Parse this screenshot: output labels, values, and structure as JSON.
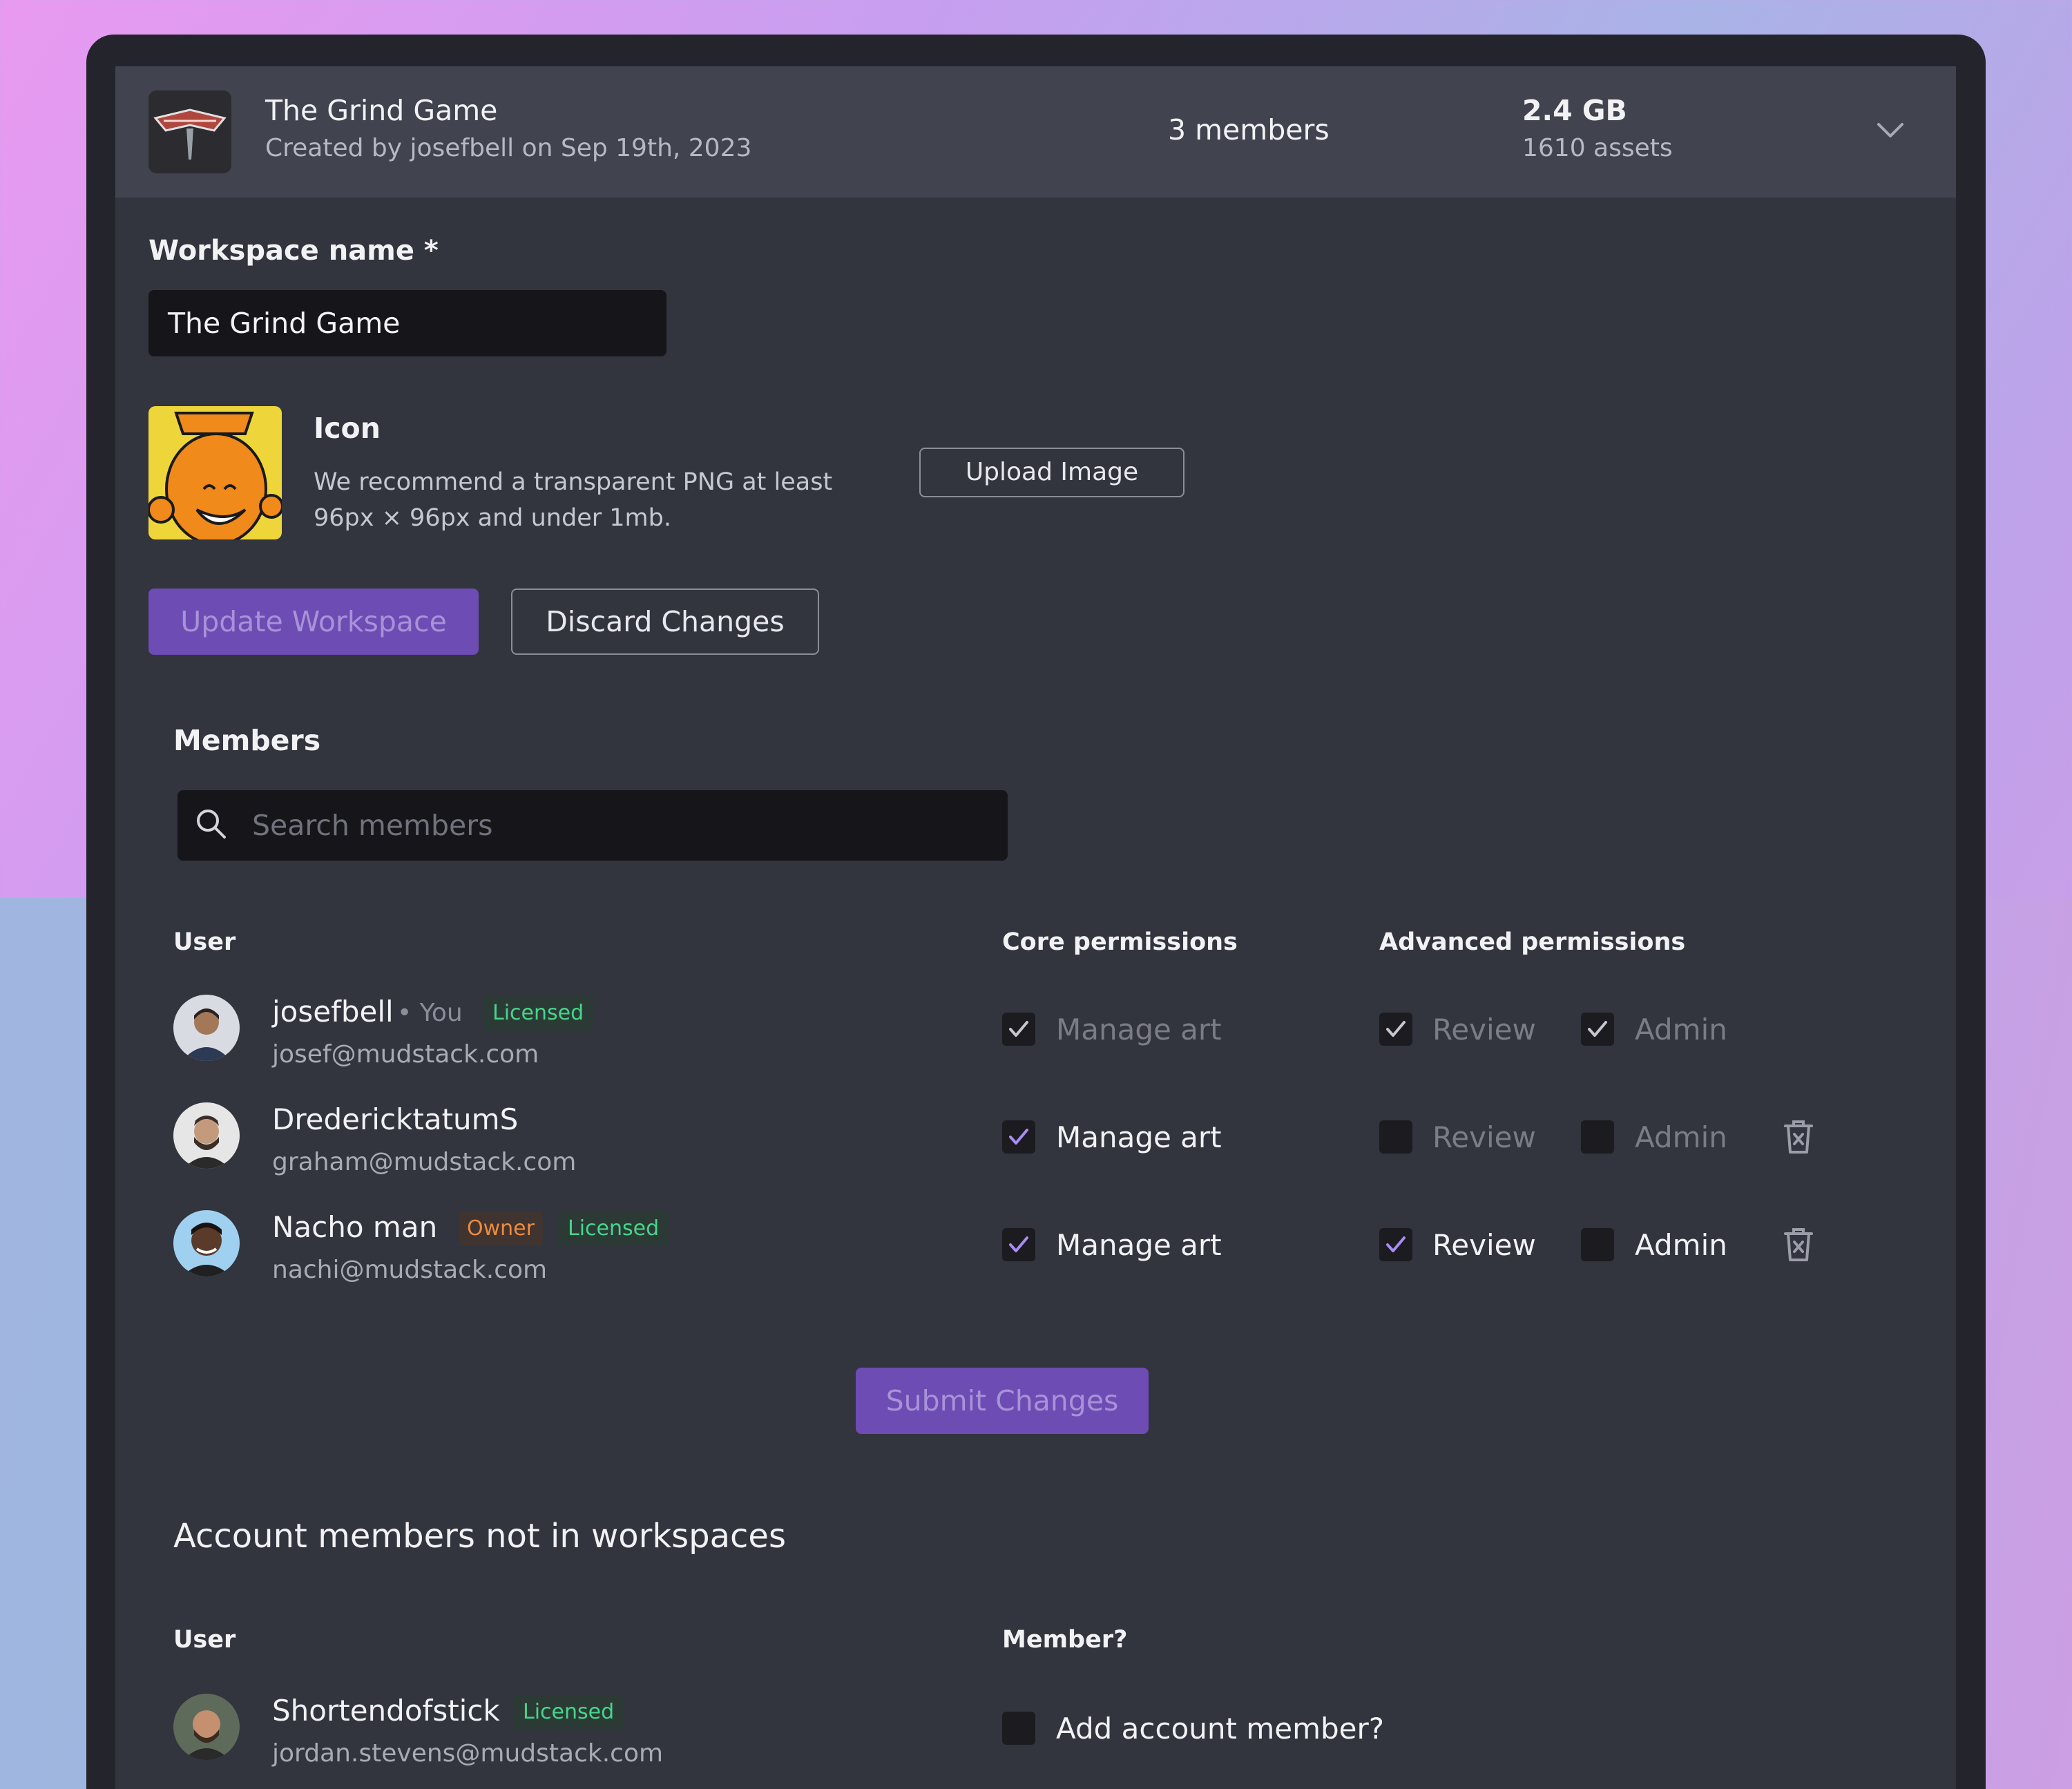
{
  "workspace": {
    "title": "The Grind Game",
    "subtitle": "Created by josefbell on Sep 19th, 2023",
    "members_count": "3 members",
    "size": "2.4 GB",
    "assets": "1610 assets"
  },
  "form": {
    "name_label": "Workspace name *",
    "name_value": "The Grind Game",
    "icon_label": "Icon",
    "icon_desc_1": "We recommend a transparent PNG at least",
    "icon_desc_2": "96px × 96px and under 1mb.",
    "upload_label": "Upload Image",
    "update_label": "Update Workspace",
    "discard_label": "Discard Changes"
  },
  "members": {
    "title": "Members",
    "search_placeholder": "Search members",
    "col_user": "User",
    "col_core": "Core permissions",
    "col_adv": "Advanced permissions",
    "rows": [
      {
        "name": "josefbell",
        "you": "• You",
        "licensed": "Licensed",
        "email": "josef@mudstack.com",
        "manage_art": "Manage art",
        "manage_art_checked": true,
        "review": "Review",
        "review_checked": true,
        "admin": "Admin",
        "admin_checked": true
      },
      {
        "name": "DredericktatumS",
        "email": "graham@mudstack.com",
        "manage_art": "Manage art",
        "manage_art_checked": true,
        "review": "Review",
        "review_checked": false,
        "admin": "Admin",
        "admin_checked": false
      },
      {
        "name": "Nacho man",
        "owner": "Owner",
        "licensed": "Licensed",
        "email": "nachi@mudstack.com",
        "manage_art": "Manage art",
        "manage_art_checked": true,
        "review": "Review",
        "review_checked": true,
        "admin": "Admin",
        "admin_checked": false
      }
    ],
    "submit_label": "Submit Changes"
  },
  "account_members": {
    "title": "Account members not in workspaces",
    "col_user": "User",
    "col_member": "Member?",
    "rows": [
      {
        "name": "Shortendofstick",
        "licensed": "Licensed",
        "email": "jordan.stevens@mudstack.com",
        "add_label": "Add account member?",
        "add_checked": false
      }
    ]
  },
  "colors": {
    "accent": "#6d4cb4",
    "check_purple": "#a98cf5",
    "licensed_green": "#46d68a",
    "owner_orange": "#f08a3c",
    "panel_bg": "#32343e"
  }
}
